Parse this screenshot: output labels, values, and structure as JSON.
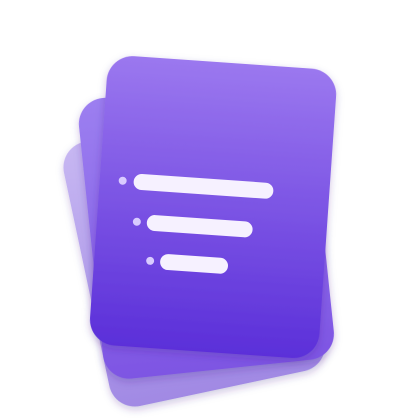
{
  "app_icon": {
    "icon_name": "stacked-documents-filter-icon",
    "colors": {
      "card_front_top": "#9b78ef",
      "card_front_bottom": "#5b2fd9",
      "card_middle": "#8f69e6",
      "card_back": "#b3a0e8",
      "line_fill": "#f6f1ff",
      "bullet_fill": "#d9cbff"
    },
    "line_count": 3
  }
}
